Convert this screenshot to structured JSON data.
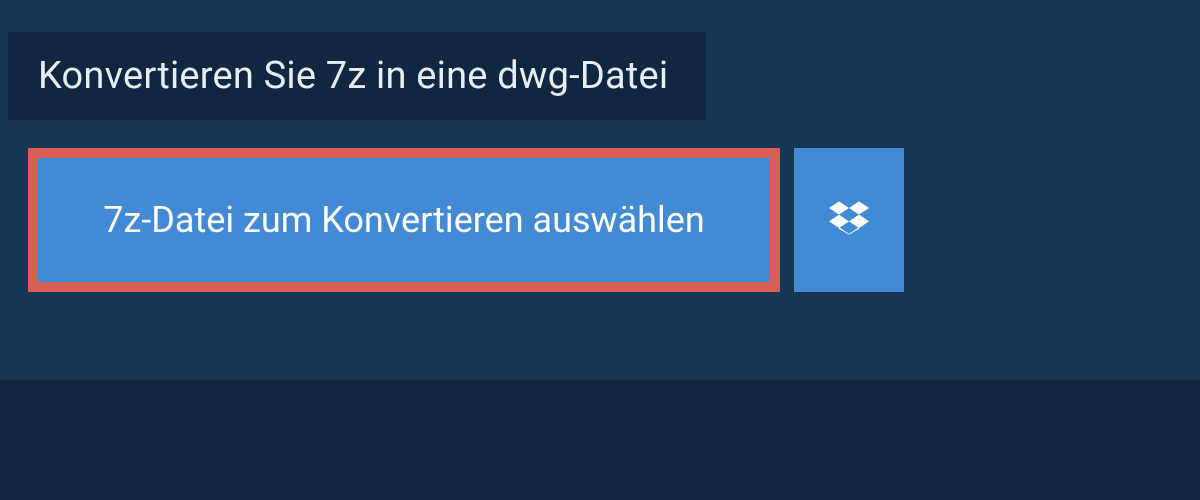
{
  "header": {
    "title": "Konvertieren Sie 7z in eine dwg-Datei"
  },
  "actions": {
    "select_file_label": "7z-Datei zum Konvertieren auswählen",
    "dropbox_icon": "dropbox"
  },
  "colors": {
    "background": "#173655",
    "panel": "#0f2740",
    "button": "#428bd4",
    "highlight_border": "#d85f56",
    "text_light": "#e8eef5",
    "text_white": "#ffffff"
  }
}
